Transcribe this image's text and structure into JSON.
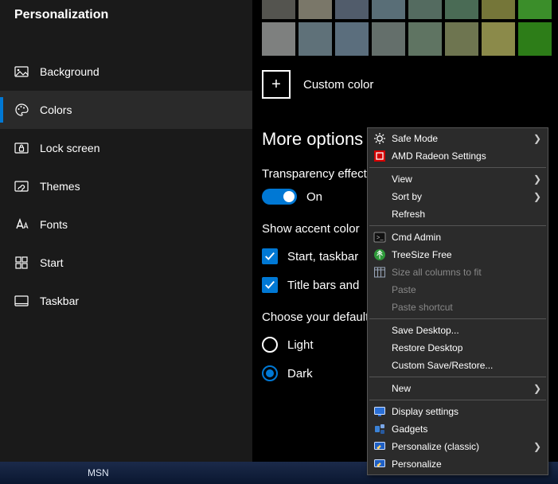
{
  "sidebar": {
    "header": "Personalization",
    "items": [
      {
        "label": "Background",
        "icon": "image"
      },
      {
        "label": "Colors",
        "icon": "palette",
        "selected": true
      },
      {
        "label": "Lock screen",
        "icon": "lock"
      },
      {
        "label": "Themes",
        "icon": "brush"
      },
      {
        "label": "Fonts",
        "icon": "font"
      },
      {
        "label": "Start",
        "icon": "start"
      },
      {
        "label": "Taskbar",
        "icon": "taskbar"
      }
    ]
  },
  "colors": {
    "rows": [
      [
        "#54544f",
        "#7a7769",
        "#515c6b",
        "#596e77",
        "#546b60",
        "#4a6b55",
        "#757639",
        "#3b8e2a"
      ],
      [
        "#7e807f",
        "#5f7179",
        "#5b6e7d",
        "#646f6b",
        "#5f7462",
        "#6e7550",
        "#8b8a4a",
        "#2d7d18"
      ]
    ],
    "custom_label": "Custom color",
    "section_title": "More options",
    "transparency": {
      "label": "Transparency effects",
      "value": "On"
    },
    "accent": {
      "label": "Show accent color",
      "option1": "Start, taskbar",
      "option2": "Title bars and"
    },
    "mode": {
      "label": "Choose your default",
      "light": "Light",
      "dark": "Dark",
      "selected": "dark"
    }
  },
  "context_menu": [
    {
      "type": "item",
      "icon": "gear-white",
      "label": "Safe Mode",
      "arrow": true
    },
    {
      "type": "item",
      "icon": "amd",
      "label": "AMD Radeon Settings"
    },
    {
      "type": "sep"
    },
    {
      "type": "item",
      "label": "View",
      "arrow": true
    },
    {
      "type": "item",
      "label": "Sort by",
      "arrow": true
    },
    {
      "type": "item",
      "label": "Refresh"
    },
    {
      "type": "sep"
    },
    {
      "type": "item",
      "icon": "cmd",
      "label": "Cmd Admin"
    },
    {
      "type": "item",
      "icon": "treesize",
      "label": "TreeSize Free"
    },
    {
      "type": "item",
      "icon": "columns",
      "label": "Size all columns to fit",
      "disabled": true
    },
    {
      "type": "item",
      "label": "Paste",
      "disabled": true
    },
    {
      "type": "item",
      "label": "Paste shortcut",
      "disabled": true
    },
    {
      "type": "sep"
    },
    {
      "type": "item",
      "label": "Save Desktop..."
    },
    {
      "type": "item",
      "label": "Restore Desktop"
    },
    {
      "type": "item",
      "label": "Custom Save/Restore..."
    },
    {
      "type": "sep"
    },
    {
      "type": "item",
      "label": "New",
      "arrow": true
    },
    {
      "type": "sep"
    },
    {
      "type": "item",
      "icon": "display",
      "label": "Display settings"
    },
    {
      "type": "item",
      "icon": "gadgets",
      "label": "Gadgets"
    },
    {
      "type": "item",
      "icon": "personalize",
      "label": "Personalize (classic)",
      "arrow": true
    },
    {
      "type": "item",
      "icon": "personalize",
      "label": "Personalize"
    }
  ],
  "taskbar": {
    "msn": "MSN"
  }
}
